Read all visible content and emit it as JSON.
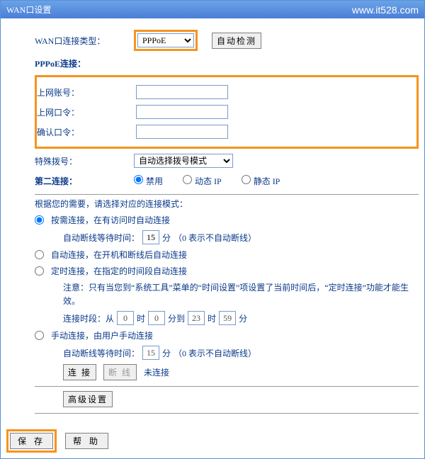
{
  "titlebar": {
    "title": "WAN口设置",
    "watermark": "www.it528.com"
  },
  "wan": {
    "type_label": "WAN口连接类型：",
    "type_value": "PPPoE",
    "autodetect_btn": "自动检测"
  },
  "pppoe": {
    "section_title": "PPPoE连接：",
    "account_label": "上网账号：",
    "account_value": "",
    "password_label": "上网口令：",
    "password_value": "",
    "confirm_label": "确认口令：",
    "confirm_value": "",
    "special_dial_label": "特殊拨号：",
    "special_dial_value": "自动选择拨号模式"
  },
  "second_conn": {
    "label": "第二连接：",
    "disabled": "禁用",
    "dynamic": "动态 IP",
    "static": "静态 IP"
  },
  "mode": {
    "intro": "根据您的需要，请选择对应的连接模式：",
    "ondemand": "按需连接，在有访问时自动连接",
    "idle_label_prefix": "自动断线等待时间：",
    "idle_value": "15",
    "idle_unit": "分",
    "idle_note": "（0 表示不自动断线）",
    "auto": "自动连接，在开机和断线后自动连接",
    "scheduled": "定时连接，在指定的时间段自动连接",
    "scheduled_note": "注意：只有当您到“系统工具”菜单的“时间设置”项设置了当前时间后，“定时连接”功能才能生效。",
    "period_label": "连接时段：从",
    "h1": "0",
    "m1": "0",
    "to": "分到",
    "h2": "23",
    "m2": "59",
    "hour_unit": "时",
    "min_unit": "分",
    "manual": "手动连接，由用户手动连接",
    "manual_idle_value": "15",
    "connect_btn": "连 接",
    "disconnect_btn": "断 线",
    "status": "未连接"
  },
  "adv": {
    "btn": "高级设置"
  },
  "footer": {
    "save": "保 存",
    "help": "帮 助"
  }
}
